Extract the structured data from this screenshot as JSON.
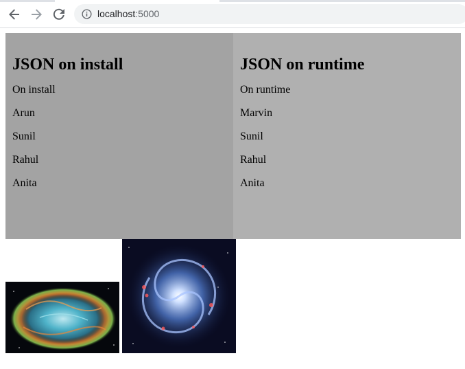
{
  "browser": {
    "url_host": "localhost",
    "url_port": ":5000",
    "icons": [
      "back-arrow-icon",
      "forward-arrow-icon",
      "reload-icon",
      "info-icon"
    ]
  },
  "panels": {
    "install": {
      "title": "JSON on install",
      "lines": [
        "On install",
        "Arun",
        "Sunil",
        "Rahul",
        "Anita"
      ]
    },
    "runtime": {
      "title": "JSON on runtime",
      "lines": [
        "On runtime",
        "Marvin",
        "Sunil",
        "Rahul",
        "Anita"
      ]
    }
  },
  "colors": {
    "install_bg": "#a3a3a3",
    "runtime_bg": "#b0b0b0"
  },
  "images": [
    "crab-nebula-image",
    "spiral-galaxy-image"
  ]
}
